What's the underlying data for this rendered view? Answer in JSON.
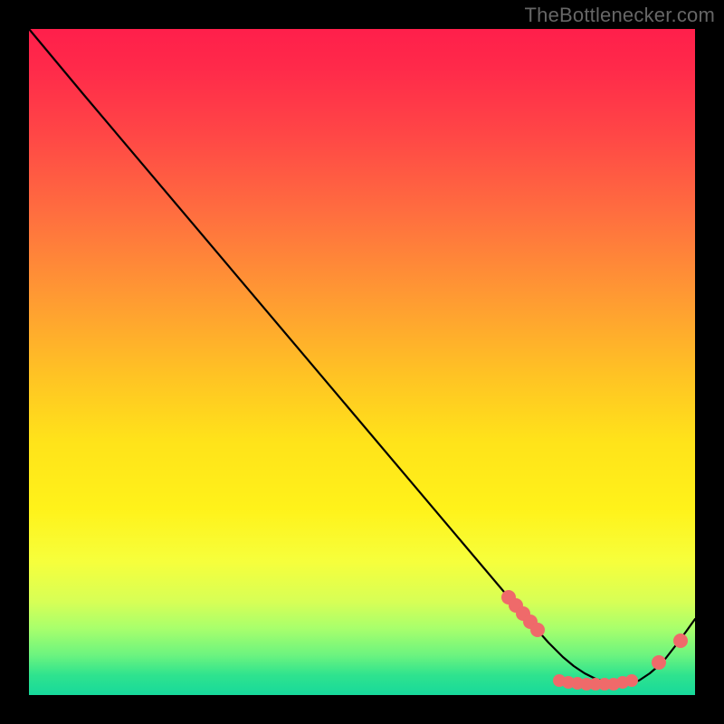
{
  "watermark": "TheBottlenecker.com",
  "colors": {
    "background": "#000000",
    "curve": "#000000",
    "marker": "#ef6a6a",
    "gradient_top": "#ff1f4b",
    "gradient_bottom": "#17d99b"
  },
  "chart_data": {
    "type": "line",
    "title": "",
    "xlabel": "",
    "ylabel": "",
    "xlim": [
      0,
      100
    ],
    "ylim": [
      0,
      100
    ],
    "series": [
      {
        "name": "curve",
        "x": [
          0,
          8,
          72,
          76,
          78,
          80,
          82,
          84,
          86,
          88,
          90,
          92,
          94,
          96,
          98,
          100
        ],
        "y": [
          100,
          90,
          15,
          10,
          8,
          6,
          4.5,
          3.5,
          2.8,
          2.2,
          1.8,
          1.8,
          2.2,
          3.5,
          6,
          11
        ]
      },
      {
        "name": "markers",
        "x": [
          72,
          73,
          74,
          75,
          76,
          80,
          81,
          82,
          83,
          84,
          85,
          86,
          87,
          89,
          90,
          95,
          98
        ],
        "y": [
          15,
          14,
          13,
          12,
          11,
          2.3,
          2.1,
          2.0,
          1.9,
          1.8,
          1.8,
          1.8,
          1.9,
          2.1,
          2.3,
          5,
          8
        ]
      }
    ],
    "background_gradient": {
      "orientation": "vertical",
      "stops": [
        {
          "pos": 0.0,
          "color": "#ff1f4b"
        },
        {
          "pos": 0.4,
          "color": "#ff9933"
        },
        {
          "pos": 0.7,
          "color": "#fff21a"
        },
        {
          "pos": 1.0,
          "color": "#17d99b"
        }
      ]
    }
  }
}
